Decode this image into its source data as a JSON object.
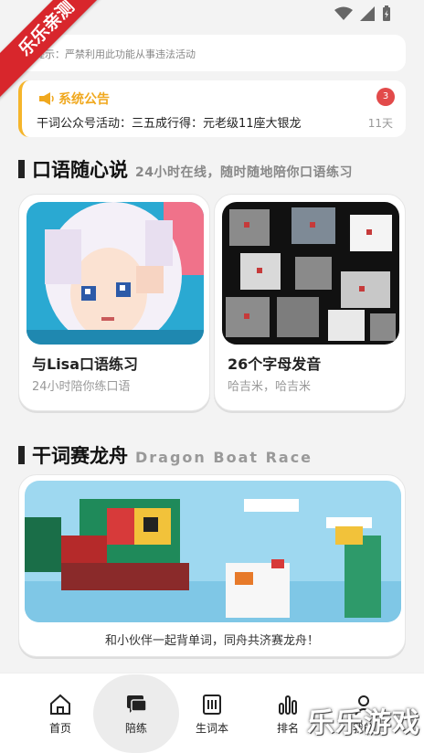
{
  "ribbon": {
    "text": "乐乐亲测"
  },
  "notice": {
    "text": "提示：严禁利用此功能从事违法活动"
  },
  "announcement": {
    "title": "系统公告",
    "badge": "3",
    "text": "干词公众号活动：三五成行得：元老级11座大银龙",
    "time": "11天"
  },
  "speaking": {
    "title": "口语随心说",
    "subtitle": "24小时在线，随时随地陪你口语练习",
    "cards": [
      {
        "title": "与Lisa口语练习",
        "subtitle": "24小时陪你练口语"
      },
      {
        "title": "26个字母发音",
        "subtitle": "哈吉米，哈吉米"
      }
    ]
  },
  "dragon": {
    "title": "干词赛龙舟",
    "subtitle": "Dragon Boat Race",
    "caption": "和小伙伴一起背单词，同舟共济赛龙舟！"
  },
  "nav": {
    "items": [
      {
        "label": "首页",
        "icon": "home-icon"
      },
      {
        "label": "陪练",
        "icon": "chat-icon",
        "active": true
      },
      {
        "label": "生词本",
        "icon": "notebook-icon"
      },
      {
        "label": "排名",
        "icon": "bar-chart-icon"
      },
      {
        "label": "我的",
        "icon": "user-icon"
      }
    ]
  },
  "watermark": {
    "text": "乐乐游戏"
  },
  "colors": {
    "accent": "#f0a81e",
    "badge": "#e24a4a",
    "ribbon": "#d8262c"
  }
}
